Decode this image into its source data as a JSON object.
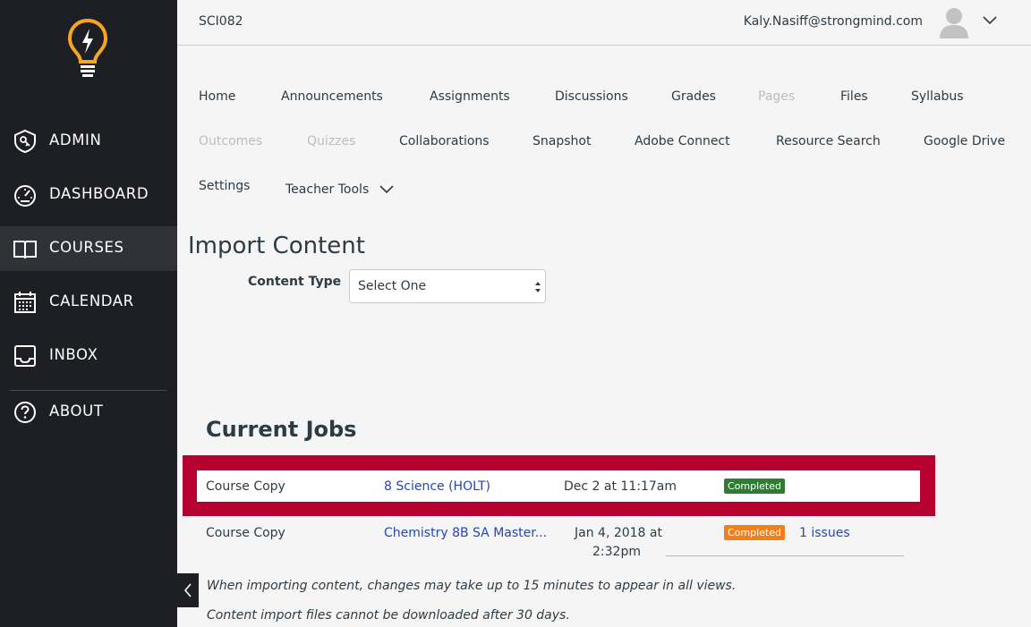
{
  "sidebar": {
    "items": [
      {
        "label": "ADMIN",
        "icon": "admin-shield-icon"
      },
      {
        "label": "DASHBOARD",
        "icon": "dashboard-gauge-icon"
      },
      {
        "label": "COURSES",
        "icon": "book-icon"
      },
      {
        "label": "CALENDAR",
        "icon": "calendar-icon"
      },
      {
        "label": "INBOX",
        "icon": "inbox-icon"
      },
      {
        "label": "ABOUT",
        "icon": "question-icon"
      }
    ],
    "active": "COURSES",
    "logo": "lightbulb-logo",
    "accent_color": "#f5a623"
  },
  "header": {
    "course_code": "SCI082",
    "user_email": "Kaly.Nasiff@strongmind.com"
  },
  "course_nav": {
    "items": [
      {
        "label": "Home",
        "disabled": false
      },
      {
        "label": "Announcements",
        "disabled": false
      },
      {
        "label": "Assignments",
        "disabled": false
      },
      {
        "label": "Discussions",
        "disabled": false
      },
      {
        "label": "Grades",
        "disabled": false
      },
      {
        "label": "Pages",
        "disabled": true
      },
      {
        "label": "Files",
        "disabled": false
      },
      {
        "label": "Syllabus",
        "disabled": false
      },
      {
        "label": "Outcomes",
        "disabled": true
      },
      {
        "label": "Quizzes",
        "disabled": true
      },
      {
        "label": "Collaborations",
        "disabled": false
      },
      {
        "label": "Snapshot",
        "disabled": false
      },
      {
        "label": "Adobe Connect",
        "disabled": false
      },
      {
        "label": "Resource Search",
        "disabled": false
      },
      {
        "label": "Google Drive",
        "disabled": false
      },
      {
        "label": "Settings",
        "disabled": false
      },
      {
        "label": "Teacher Tools",
        "disabled": false
      }
    ]
  },
  "import": {
    "title": "Import Content",
    "content_type_label": "Content Type",
    "content_type_value": "Select One"
  },
  "jobs": {
    "title": "Current Jobs",
    "rows": [
      {
        "type": "Course Copy",
        "source": "8 Science (HOLT)",
        "date": "Dec 2 at 11:17am",
        "date_line2": "",
        "status": "Completed",
        "status_color": "#2e7d32",
        "issues": ""
      },
      {
        "type": "Course Copy",
        "source": "Chemistry 8B SA Master...",
        "date": "Jan 4, 2018 at",
        "date_line2": "2:32pm",
        "status": "Completed",
        "status_color": "#f0801a",
        "issues": "1 issues"
      }
    ],
    "highlight_color": "#b7002f"
  },
  "notes": {
    "line1": "When importing content, changes may take up to 15 minutes to appear in all views.",
    "line2": "Content import files cannot be downloaded after 30 days."
  }
}
